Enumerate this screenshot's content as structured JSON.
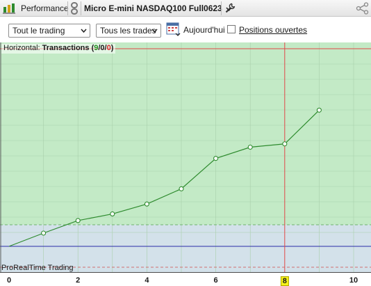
{
  "titlebar": {
    "performance_label": "Performance",
    "instrument_label": "Micro E-mini NASDAQ100 Full0623"
  },
  "toolbar": {
    "scope_select": "Tout le trading",
    "trades_select": "Tous les trades",
    "today_label": "Aujourd'hui",
    "open_positions_label": "Positions ouvertes",
    "open_positions_checked": false
  },
  "chart": {
    "horizontal_prefix": "Horizontal:",
    "horizontal_name": "Transactions",
    "count_open": "(",
    "count_a": "9",
    "count_sep1": "/",
    "count_b": "0",
    "count_sep2": "/",
    "count_c": "0",
    "count_close": ")",
    "footer_label": "ProRealTime Trading",
    "colors": {
      "profit_zone": "#c3eac6",
      "neutral_zone": "#d3e1ea",
      "line": "#2e8b2e",
      "baseline": "#2a2aa8",
      "crosshair": "#e24848"
    }
  },
  "chart_data": {
    "type": "line",
    "x": [
      0,
      1,
      2,
      3,
      4,
      5,
      6,
      7,
      8,
      9
    ],
    "values": [
      0,
      1.0,
      1.95,
      2.45,
      3.2,
      4.35,
      6.65,
      7.5,
      7.75,
      10.3
    ],
    "xticks": [
      "0",
      "2",
      "4",
      "6",
      "8",
      "10"
    ],
    "highlighted_x": "8",
    "xlim": [
      0,
      10.4
    ],
    "grid": true
  }
}
